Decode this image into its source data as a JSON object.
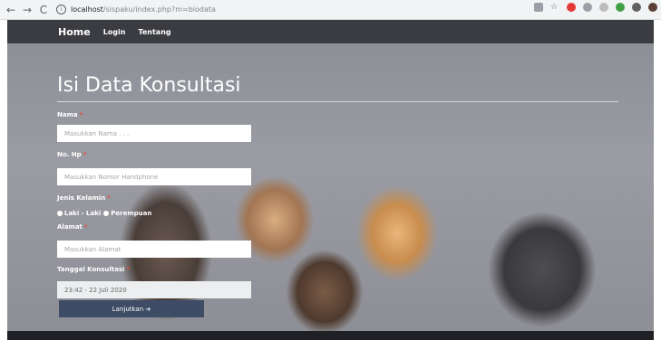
{
  "browser": {
    "url_host": "localhost",
    "url_path": "/sispaku/index.php?m=biodata"
  },
  "nav": {
    "brand": "Home",
    "links": [
      "Login",
      "Tentang"
    ]
  },
  "form": {
    "title": "Isi Data Konsultasi",
    "nama": {
      "label": "Nama",
      "placeholder": "Masukkan Nama . . ."
    },
    "hp": {
      "label": "No. Hp",
      "placeholder": "Masukkan Nomor Handphone"
    },
    "gender": {
      "label": "Jenis Kelamin",
      "options": [
        "Laki - Laki",
        "Perempuan"
      ]
    },
    "alamat": {
      "label": "Alamat",
      "placeholder": "Masukkan Alamat"
    },
    "tanggal": {
      "label": "Tanggal Konsultasi",
      "value": "23:42 - 22 Juli 2020"
    },
    "required_mark": "*",
    "submit_label": "Lanjutkan ➔"
  },
  "colors": {
    "navbar": "#3b3c41",
    "button": "#3e4c66",
    "required": "#e74c3c"
  }
}
